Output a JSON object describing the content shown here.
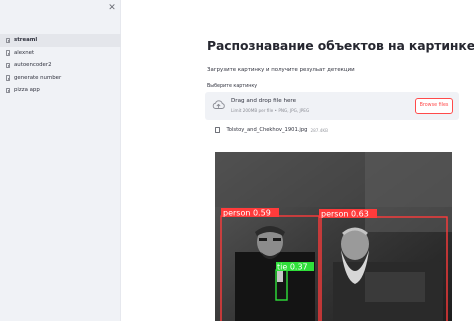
{
  "sidebar": {
    "close_glyph": "✕",
    "items": [
      {
        "label": "streaml",
        "active": true
      },
      {
        "label": "alexnet",
        "active": false
      },
      {
        "label": "autoencoder2",
        "active": false
      },
      {
        "label": "generate number",
        "active": false
      },
      {
        "label": "pizza app",
        "active": false
      }
    ]
  },
  "main": {
    "title": "Распознавание объектов на картинке",
    "subtitle": "Загрузите картинку и получите резульат детекции",
    "uploader": {
      "label": "Выберите картинку",
      "drop_title": "Drag and drop file here",
      "limit_text": "Limit 200MB per file • PNG, JPG, JPEG",
      "browse_label": "Browse files",
      "cloud_icon": "upload-cloud-icon"
    },
    "file": {
      "name": "Tolstoy_and_Chekhov_1901.jpg",
      "size": "287.4KB"
    },
    "detections": [
      {
        "label": "person 0.59",
        "color": "#ff3b3b"
      },
      {
        "label": "person 0.63",
        "color": "#ff3b3b"
      },
      {
        "label": "tie 0.37",
        "color": "#2fe03a"
      }
    ]
  },
  "colors": {
    "accent": "#ff4b4b",
    "sidebar_bg": "#f0f2f6",
    "person_box": "#ff3b3b",
    "tie_box": "#2fe03a"
  }
}
